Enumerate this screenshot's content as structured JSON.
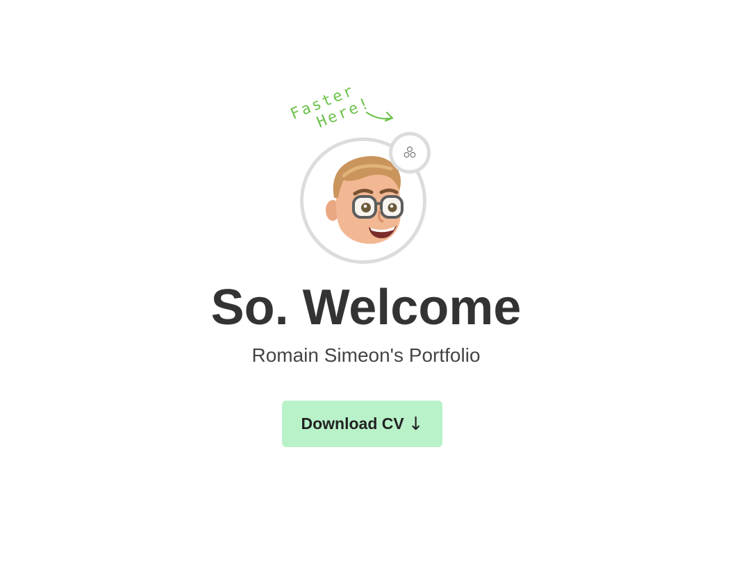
{
  "handnote": {
    "line1": "Faster",
    "line2": "Here!",
    "color": "#6cc24a",
    "icon": "curved-arrow-icon"
  },
  "avatar": {
    "icon": "memoji-avatar",
    "ring_color": "#dcdcdc"
  },
  "menu_button": {
    "icon": "three-circles-icon"
  },
  "hero": {
    "title": "So. Welcome",
    "subtitle": "Romain Simeon's Portfolio"
  },
  "cta": {
    "label": "Download CV",
    "arrow": "↓",
    "background": "#b9f2c9"
  }
}
